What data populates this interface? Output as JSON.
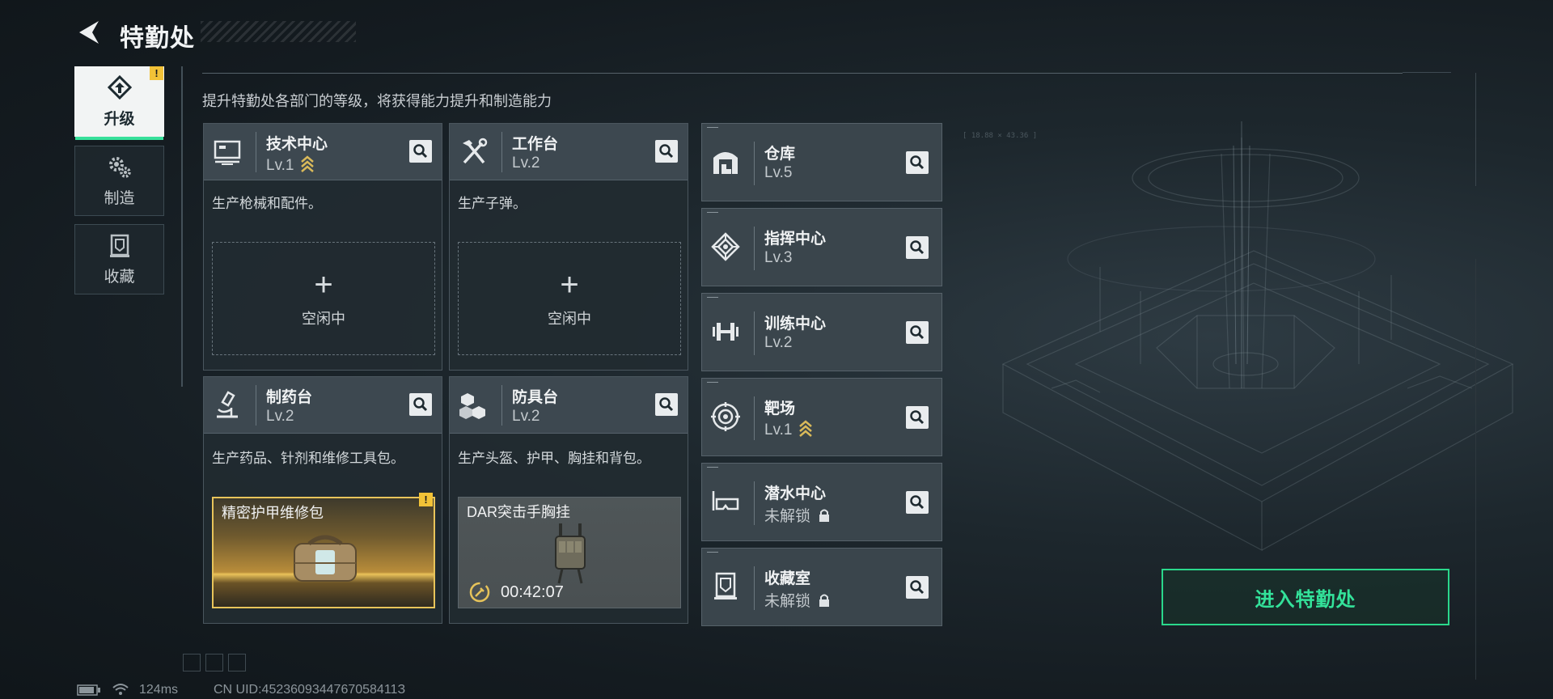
{
  "header": {
    "title": "特勤处"
  },
  "nav": {
    "items": [
      {
        "label": "升级",
        "icon": "upgrade-icon",
        "active": true,
        "alert": "!"
      },
      {
        "label": "制造",
        "icon": "gears-icon",
        "active": false
      },
      {
        "label": "收藏",
        "icon": "collection-icon",
        "active": false
      }
    ]
  },
  "subtitle": "提升特勤处各部门的等级，将获得能力提升和制造能力",
  "buildings": [
    {
      "name": "技术中心",
      "level": "Lv.1",
      "upgradable": true,
      "desc": "生产枪械和配件。",
      "slot": {
        "state": "idle",
        "plus": "+",
        "label": "空闲中"
      }
    },
    {
      "name": "工作台",
      "level": "Lv.2",
      "desc": "生产子弹。",
      "slot": {
        "state": "idle",
        "plus": "+",
        "label": "空闲中"
      }
    },
    {
      "name": "制药台",
      "level": "Lv.2",
      "desc": "生产药品、针剂和维修工具包。",
      "slot": {
        "state": "done",
        "item": "精密护甲维修包",
        "alert": "!"
      }
    },
    {
      "name": "防具台",
      "level": "Lv.2",
      "desc": "生产头盔、护甲、胸挂和背包。",
      "slot": {
        "state": "producing",
        "item": "DAR突击手胸挂",
        "timer": "00:42:07"
      }
    }
  ],
  "facilities": [
    {
      "name": "仓库",
      "level": "Lv.5",
      "icon": "warehouse-icon"
    },
    {
      "name": "指挥中心",
      "level": "Lv.3",
      "icon": "command-center-icon"
    },
    {
      "name": "训练中心",
      "level": "Lv.2",
      "icon": "dumbbell-icon"
    },
    {
      "name": "靶场",
      "level": "Lv.1",
      "icon": "target-icon",
      "upgradable": true
    },
    {
      "name": "潜水中心",
      "level": "未解锁",
      "icon": "diving-mask-icon",
      "locked": true
    },
    {
      "name": "收藏室",
      "level": "未解锁",
      "icon": "collection-room-icon",
      "locked": true
    }
  ],
  "enter_button": "进入特勤处",
  "status_bar": {
    "ping": "124ms",
    "uid": "CN UID:4523609344767058411З"
  },
  "colors": {
    "accent_green": "#33e29a",
    "alert_yellow": "#f2c237",
    "gold": "#e8c45a"
  }
}
